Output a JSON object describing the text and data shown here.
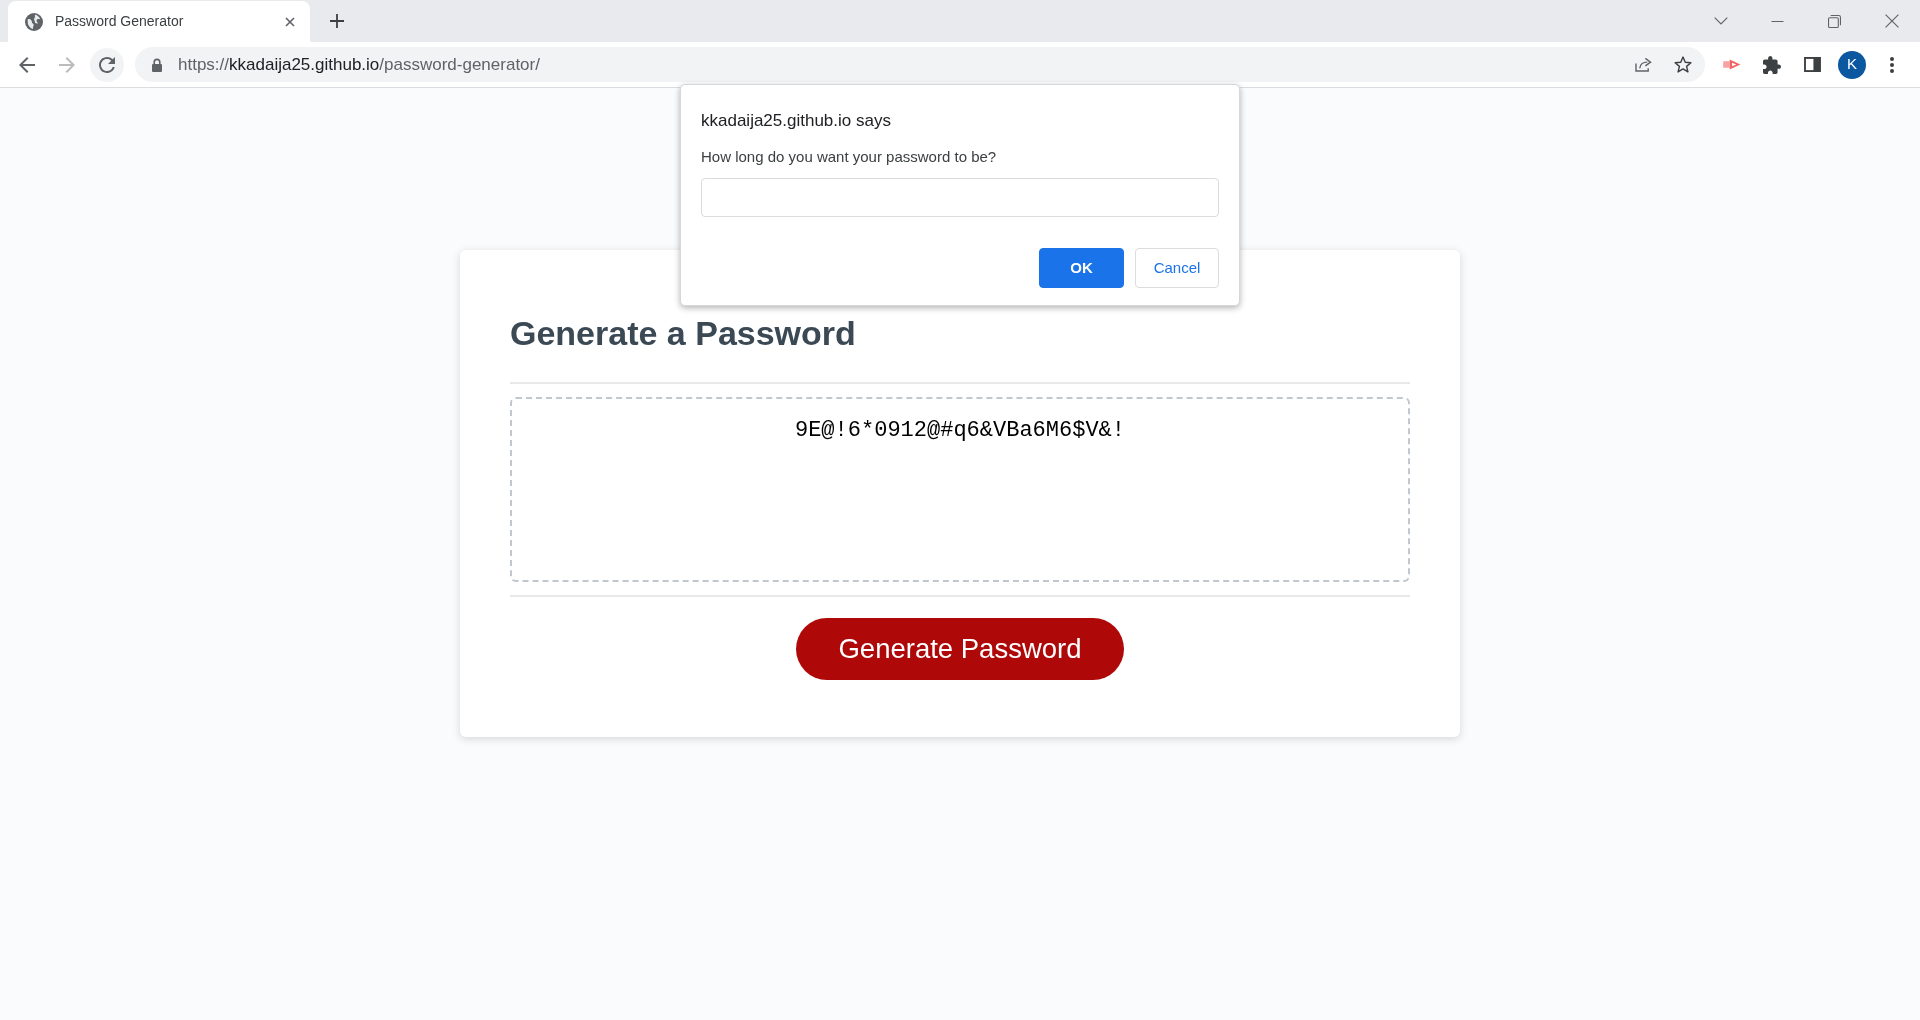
{
  "browser": {
    "tabs": [
      {
        "title": "Password Generator",
        "selected": true
      }
    ],
    "nav_buttons": [
      {
        "kind": "back",
        "disabled": false,
        "hovered": false
      },
      {
        "kind": "forward",
        "disabled": true,
        "hovered": false
      },
      {
        "kind": "reload",
        "disabled": false,
        "hovered": true
      }
    ],
    "url": {
      "scheme": "https://",
      "host": "kkadaija25.github.io",
      "path": "/password-generator/"
    },
    "profile_initial": "K"
  },
  "page": {
    "heading": "Generate a Password",
    "password": "9E@!6*0912@#q6&VBa6M6$V&!",
    "button": "Generate Password"
  },
  "dialog": {
    "title": "kkadaija25.github.io says",
    "message": "How long do you want your password to be?",
    "buttons": [
      {
        "label": "OK",
        "kind": "primary"
      },
      {
        "label": "Cancel",
        "kind": "secondary"
      }
    ]
  }
}
